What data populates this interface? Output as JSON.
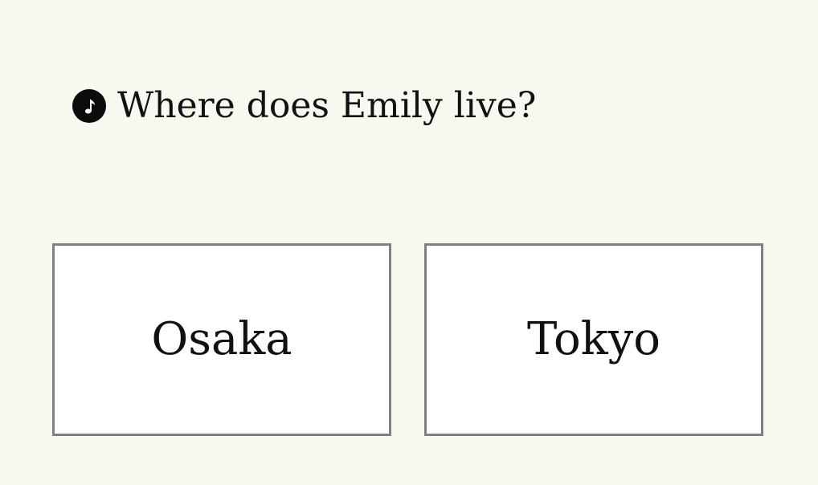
{
  "question": {
    "audio_icon": "music-note-icon",
    "text": "Where does Emily live?"
  },
  "choices": [
    {
      "label": "Osaka"
    },
    {
      "label": "Tokyo"
    }
  ],
  "colors": {
    "background": "#f8f7f0",
    "card_background": "#ffffff",
    "card_border": "#808080",
    "text": "#111111",
    "audio_button": "#0b0b0b"
  }
}
